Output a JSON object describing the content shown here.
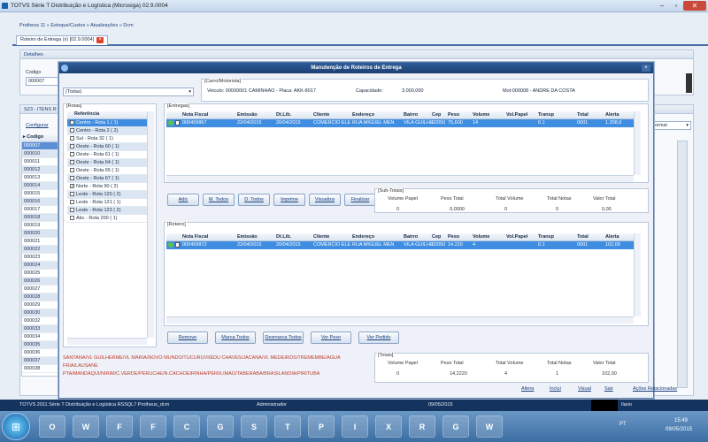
{
  "window": {
    "title": "TOTVS Série T Distribuição e Logística (Microsiga) 02.9.0004"
  },
  "breadcrumb": "Protheus 11 » Estoque/Custos » Atualizações » Dcm",
  "tab": {
    "label": "Roteiro de Entrega (x) [02.9.0004]"
  },
  "detalhes": {
    "section": "Detalhes",
    "codigo_label": "Codigo",
    "codigo_value": "000007"
  },
  "sz3": {
    "section": "SZ3 - ITENS R",
    "configurar": "Configurar",
    "col_codigo": "Codigo",
    "codes": [
      "000007",
      "000010",
      "000011",
      "000012",
      "000013",
      "000014",
      "000015",
      "000016",
      "000017",
      "000018",
      "000019",
      "000020",
      "000021",
      "000022",
      "000023",
      "000024",
      "000025",
      "000026",
      "000027",
      "000028",
      "000029",
      "000030",
      "000032",
      "000033",
      "000034",
      "000035",
      "000036",
      "000037",
      "000038"
    ]
  },
  "right_panel": {
    "select": "Normal"
  },
  "dialog": {
    "title": "Manutenção de Roteiros de Entrega",
    "filter_select": "(Todas)",
    "carro": {
      "group": "[Carro/Motorista]",
      "veiculo": "Veiculo: 00000001   CAMINHAO - Placa: AKK-8017",
      "capacidade": "Capacidade:",
      "capacidade_val": "3.000,000",
      "mot": "Mot:000008 - ANDRE DA COSTA"
    },
    "rotas": {
      "group": "[Rotas]",
      "col": "Referência",
      "items": [
        {
          "label": "Centro - Rota 1 ( 1)",
          "checked": true
        },
        {
          "label": "Centro - Rota 2 ( 2)",
          "checked": false
        },
        {
          "label": "Sul - Rota 32 ( 1)",
          "checked": false
        },
        {
          "label": "Oeste - Rota 60 ( 1)",
          "checked": false
        },
        {
          "label": "Oeste - Rota 61 ( 1)",
          "checked": false
        },
        {
          "label": "Oeste - Rota 64 ( 1)",
          "checked": false
        },
        {
          "label": "Oeste - Rota 65 ( 1)",
          "checked": false
        },
        {
          "label": "Oeste - Rota 67 ( 1)",
          "checked": false
        },
        {
          "label": "Norte - Rota 90 ( 2)",
          "checked": true
        },
        {
          "label": "Leste - Rota 120 ( 2)",
          "checked": false
        },
        {
          "label": "Leste - Rota 121 ( 1)",
          "checked": false
        },
        {
          "label": "Leste - Rota 123 ( 2)",
          "checked": false
        },
        {
          "label": "Abc - Rota 200 ( 1)",
          "checked": false
        }
      ]
    },
    "entregas": {
      "group": "[Entregas]",
      "cols": [
        "Nota Fiscal",
        "Emissão",
        "Dt.Lib.",
        "Cliente",
        "Endereço",
        "Bairro",
        "Cep",
        "Peso",
        "Volume",
        "Vol.Papel",
        "Transp",
        "Total",
        "Alerta"
      ],
      "row": [
        "000459867",
        "22/04/2015",
        "20/04/2015",
        "COMERCIO ELE",
        "RUA MIGUEL MEN",
        "VILA GUILHE",
        "02050",
        "75,600",
        "14",
        "",
        "0.1",
        "0001",
        "1.208,9"
      ]
    },
    "buttons1": [
      "Adic",
      "M. Todos",
      "D. Todos",
      "Imprime",
      "Visualiza",
      "Finalizar"
    ],
    "subtotais": {
      "group": "[Sub-Totais]",
      "labels": [
        "Volume Papel",
        "Peso Total",
        "Total Volume",
        "Total Notas",
        "Valor Total"
      ],
      "values": [
        "0",
        "0,0000",
        "0",
        "0",
        "0,00"
      ]
    },
    "roteiro": {
      "group": "[Roteiro]",
      "cols": [
        "Nota Fiscal",
        "Emissão",
        "Dt.Lib.",
        "Cliente",
        "Endereço",
        "Bairro",
        "Cep",
        "Peso",
        "Volume",
        "Vol.Papel",
        "Transp",
        "Total",
        "Alerta"
      ],
      "row": [
        "000459872",
        "22/04/2015",
        "20/04/2015",
        "COMERCIO ELE",
        "RUA MIGUEL MEN",
        "VILA GUILHE",
        "02050",
        "14.220",
        "4",
        "",
        "0.1",
        "0001",
        "102,00"
      ]
    },
    "buttons2": [
      "Remove",
      "Marca Todos",
      "Desmarca Todos",
      "Ver Peso",
      "Ver Pedido"
    ],
    "route_text_line1": "SANTANA/VL GUILHERME/VL MARIA/NOVO MUNDO/TUCURUVI/EDU CHAVES/JACANA/VL MEDEIROS/TREMEMBE/AGUA FRIA/LAUSANE",
    "route_text_line2": "PTA/MANDAQUI/NIRIM/C.VERDE/PERUCHE/N.CACHOEIRINHA/PERI/LIMAO/TABERABA/BRASILANDIA/PIRITUBA",
    "totais": {
      "group": "[Totais]",
      "labels": [
        "Volume Papel",
        "Peso Total",
        "Total Volume",
        "Total Notas",
        "Valor Total"
      ],
      "values": [
        "0",
        "14,2220",
        "4",
        "1",
        "102,00"
      ]
    }
  },
  "bottom_links": [
    "Altera",
    "Inclui",
    "Visual",
    "Sair",
    "Ações Relacionadas"
  ],
  "statusbar": {
    "left": "TOTVS 2011 Série T Distribuição e Logística RSSQL7 Protheus_dcm",
    "user": "Administrador",
    "date": "09/05/2015",
    "right": "Ilario"
  },
  "taskbar": {
    "lang": "PT",
    "time": "15:49",
    "date": "09/05/2015",
    "apps": [
      "O",
      "W",
      "F",
      "F",
      "C",
      "G",
      "S",
      "T",
      "P",
      "I",
      "X",
      "R",
      "G",
      "W"
    ]
  },
  "colors": {
    "title_blue": "#1d3f72",
    "selection": "#3f8de0",
    "status": "#14335e"
  }
}
